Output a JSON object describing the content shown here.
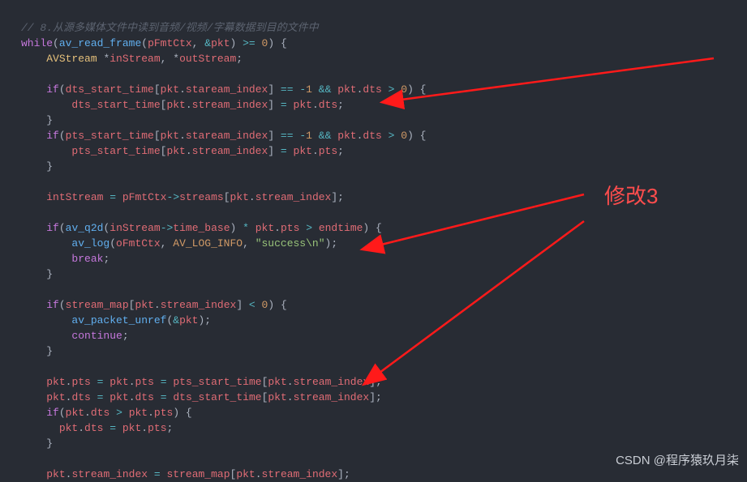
{
  "annotation_label": "修改3",
  "watermark": "CSDN @程序猿玖月柒",
  "code": {
    "l1_comment": "// 8.从源多媒体文件中读到音频/视频/字幕数据到目的文件中",
    "l2_while": "while",
    "l2_fn": "av_read_frame",
    "l2_arg1": "pFmtCtx",
    "l2_arg2": "pkt",
    "l2_cmp": ">=",
    "l2_zero": "0",
    "l3_type": "AVStream",
    "l3_v1": "inStream",
    "l3_v2": "outStream",
    "l5_if": "if",
    "l5_arr": "dts_start_time",
    "l5_pkt": "pkt",
    "l5_idx": "staream_index",
    "l5_eq": "==",
    "l5_neg1": "-1",
    "l5_and": "&&",
    "l5_dts": "dts",
    "l5_gt": ">",
    "l5_zero": "0",
    "l6_arr": "dts_start_time",
    "l6_pkt": "pkt",
    "l6_idx": "stream_index",
    "l6_assign": "=",
    "l6_dts": "dts",
    "l8_if": "if",
    "l8_arr": "pts_start_time",
    "l8_pkt": "pkt",
    "l8_idx": "staream_index",
    "l8_eq": "==",
    "l8_neg1": "-1",
    "l8_and": "&&",
    "l8_dts": "dts",
    "l8_gt": ">",
    "l8_zero": "0",
    "l9_arr": "pts_start_time",
    "l9_pkt": "pkt",
    "l9_idx": "stream_index",
    "l9_assign": "=",
    "l9_pts": "pts",
    "l12_var": "intStream",
    "l12_assign": "=",
    "l12_obj": "pFmtCtx",
    "l12_arrow": "->",
    "l12_prop": "streams",
    "l12_pkt": "pkt",
    "l12_idx": "stream_index",
    "l14_if": "if",
    "l14_fn": "av_q2d",
    "l14_obj": "inStream",
    "l14_arrow": "->",
    "l14_tb": "time_base",
    "l14_mul": "*",
    "l14_pkt": "pkt",
    "l14_pts": "pts",
    "l14_gt": ">",
    "l14_end": "endtime",
    "l15_fn": "av_log",
    "l15_a1": "oFmtCtx",
    "l15_a2": "AV_LOG_INFO",
    "l15_str": "\"success\\n\"",
    "l16_break": "break",
    "l19_if": "if",
    "l19_arr": "stream_map",
    "l19_pkt": "pkt",
    "l19_idx": "stream_index",
    "l19_lt": "<",
    "l19_zero": "0",
    "l20_fn": "av_packet_unref",
    "l20_arg": "pkt",
    "l21_cont": "continue",
    "l24_pkt": "pkt",
    "l24_pts": "pts",
    "l24_assign": "=",
    "l24_arr": "pts_start_time",
    "l24_idx": "stream_index",
    "l25_pkt": "pkt",
    "l25_dts": "dts",
    "l25_assign": "=",
    "l25_arr": "dts_start_time",
    "l25_idx": "stream_index",
    "l26_if": "if",
    "l26_pkt": "pkt",
    "l26_dts": "dts",
    "l26_gt": ">",
    "l26_pts": "pts",
    "l27_pkt": "pkt",
    "l27_dts": "dts",
    "l27_assign": "=",
    "l27_pts": "pts",
    "l30_pkt": "pkt",
    "l30_si": "stream_index",
    "l30_assign": "=",
    "l30_arr": "stream_map"
  }
}
